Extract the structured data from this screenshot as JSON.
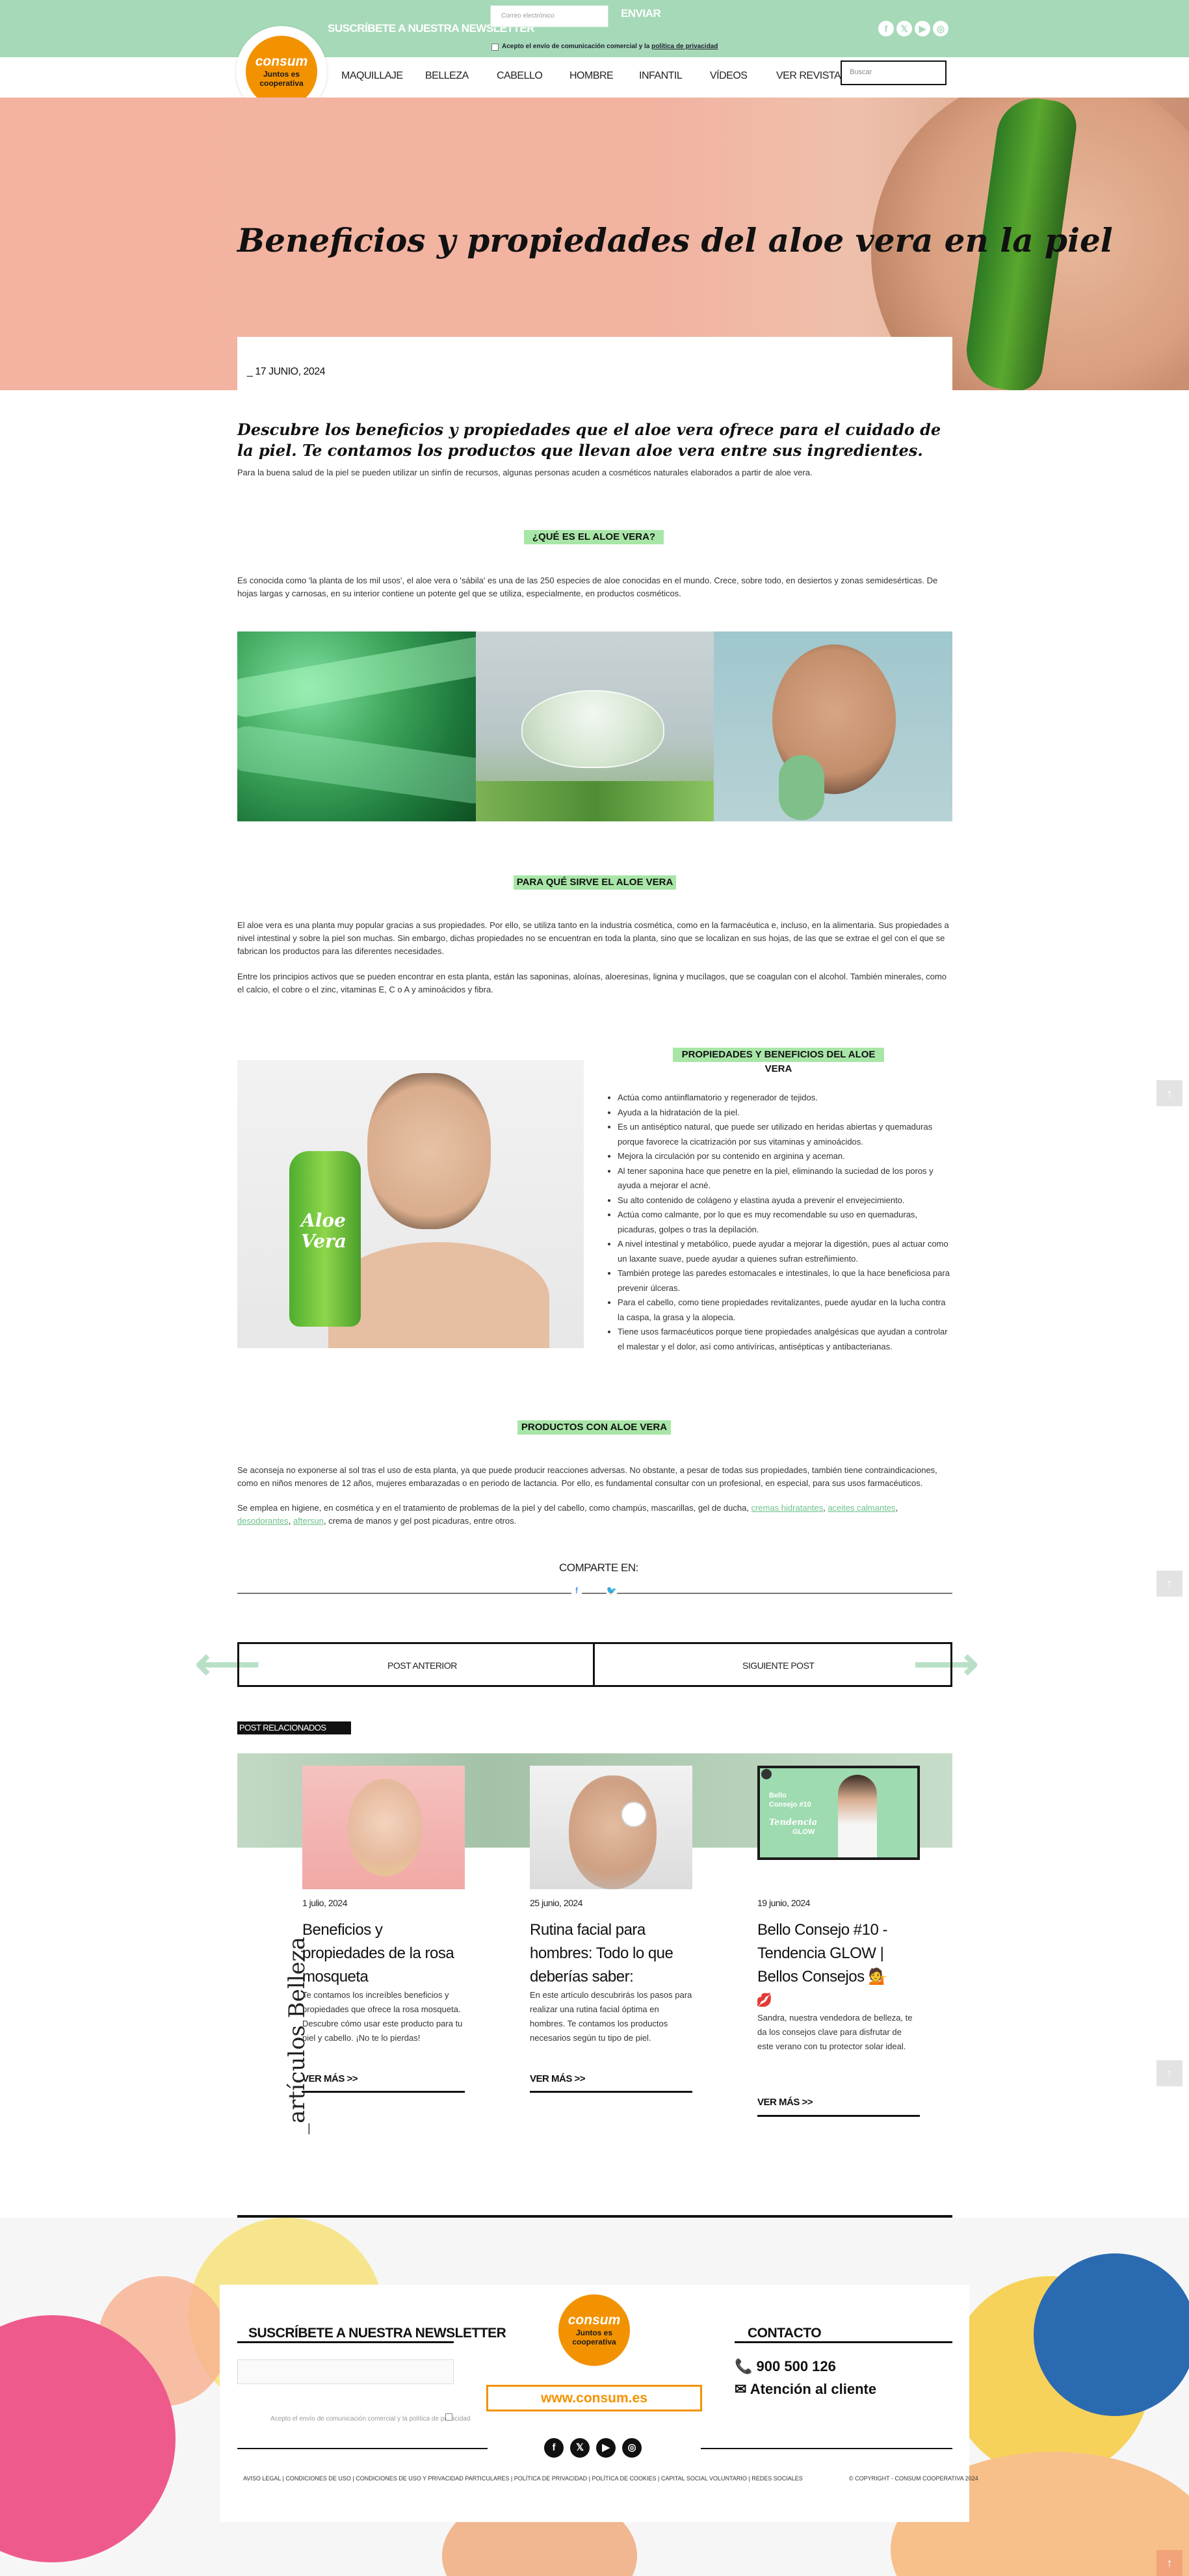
{
  "topbar": {
    "newsletter_title": "SUSCRÍBETE A NUESTRA NEWSLETTER",
    "email_placeholder": "Correo electrónico",
    "send_label": "ENVIAR",
    "accept_text": "Acepto el envío de comunicación comercial y la",
    "privacy_link": "política de privacidad",
    "social_icons": [
      "facebook-icon",
      "x-icon",
      "youtube-icon",
      "instagram-icon"
    ]
  },
  "brand": {
    "logo_word": "consum",
    "logo_sub_1": "Juntos es",
    "logo_sub_2": "cooperativa",
    "accent_color": "#f39200",
    "green_color": "#a6d9b8"
  },
  "nav": {
    "items": [
      "MAQUILLAJE",
      "BELLEZA",
      "CABELLO",
      "HOMBRE",
      "INFANTIL",
      "VÍDEOS",
      "VER REVISTA"
    ],
    "search_placeholder": "Buscar"
  },
  "hero": {
    "title": "Beneficios y propiedades del aloe vera en la piel",
    "date": "_ 17 JUNIO, 2024"
  },
  "article": {
    "intro_heading": "Descubre los beneficios y propiedades que el aloe vera ofrece para el cuidado de la piel. Te contamos los productos que llevan aloe vera entre sus ingredientes.",
    "intro_text": "Para la buena salud de la piel se pueden utilizar un sinfín de recursos, algunas personas acuden a cosméticos naturales elaborados a partir de aloe vera.",
    "section1_tag": "¿QUÉ ES EL ALOE VERA?",
    "section1_text": "Es conocida como 'la planta de los mil usos', el aloe vera o 'sábila' es una de las 250 especies de aloe conocidas en el mundo. Crece, sobre todo, en desiertos y zonas semidesérticas. De hojas largas y carnosas, en su interior contiene un potente gel que se utiliza, especialmente, en productos cosméticos.",
    "section2_tag": "PARA QUÉ SIRVE EL ALOE VERA",
    "section2_p1": "El aloe vera es una planta muy popular gracias a sus propiedades. Por ello, se utiliza tanto en la industria cosmética, como en la farmacéutica e, incluso, en la alimentaria. Sus propiedades a nivel intestinal y sobre la piel son muchas. Sin embargo, dichas propiedades no se encuentran en toda la planta, sino que se localizan en sus hojas, de las que se extrae el gel con el que se fabrican los productos para las diferentes necesidades.",
    "section2_p2": "Entre los principios activos que se pueden encontrar en esta planta, están las saponinas, aloínas, aloeresinas, lignina y mucílagos, que se coagulan con el alcohol. También minerales, como el calcio, el cobre o el zinc, vitaminas E, C o A y aminoácidos y fibra.",
    "section3_tag": "PROPIEDADES Y BENEFICIOS DEL ALOE VERA",
    "bottle_label_1": "Aloe",
    "bottle_label_2": "Vera",
    "benefits": [
      "Actúa como antiinflamatorio y regenerador de tejidos.",
      "Ayuda a la hidratación de la piel.",
      "Es un antiséptico natural, que puede ser utilizado en heridas abiertas y quemaduras porque favorece la cicatrización por sus vitaminas y aminoácidos.",
      "Mejora la circulación por su contenido en arginina y aceman.",
      "Al tener saponina hace que penetre en la piel, eliminando la suciedad de los poros y ayuda a mejorar el acné.",
      "Su alto contenido de colágeno y elastina ayuda a prevenir el envejecimiento.",
      "Actúa como calmante, por lo que es muy recomendable su uso en quemaduras, picaduras, golpes o tras la depilación.",
      "A nivel intestinal y metabólico, puede ayudar a mejorar la digestión, pues al actuar como un laxante suave, puede ayudar a quienes sufran estreñimiento.",
      "También protege las paredes estomacales e intestinales, lo que la hace beneficiosa para prevenir úlceras.",
      "Para el cabello, como tiene propiedades revitalizantes, puede ayudar en la lucha contra la caspa, la grasa y la alopecia.",
      "Tiene usos farmacéuticos porque tiene propiedades analgésicas que ayudan a controlar el malestar y el dolor, así como antivíricas, antisépticas y antibacterianas."
    ],
    "section4_tag": "PRODUCTOS CON ALOE VERA",
    "section4_p1": "Se aconseja no exponerse al sol tras el uso de esta planta, ya que puede producir reacciones adversas. No obstante, a pesar de todas sus propiedades, también tiene contraindicaciones, como en niños menores de 12 años, mujeres embarazadas o en periodo de lactancia. Por ello, es fundamental consultar con un profesional, en especial, para sus usos farmacéuticos.",
    "section4_p2_a": "Se emplea en higiene, en cosmética y en el tratamiento de problemas de la piel y del cabello, como champús, mascarillas, gel de ducha,",
    "link_1": "cremas hidratantes",
    "link_2": "aceites calmantes",
    "link_3": "desodorantes",
    "link_4": "aftersun",
    "section4_p2_b": ", crema de manos y gel post picaduras, entre otros."
  },
  "share": {
    "label": "COMPARTE EN:",
    "icons": [
      "facebook-icon",
      "twitter-icon"
    ]
  },
  "post_nav": {
    "prev": "POST ANTERIOR",
    "next": "SIGUIENTE POST"
  },
  "related": {
    "tag": "POST RELACIONADOS",
    "side_label": "_artículos Belleza",
    "video_title_1": "Bello",
    "video_title_2": "Consejo #10",
    "video_title_3": "Tendencia",
    "video_title_4": "GLOW",
    "cards": [
      {
        "date": "1 julio, 2024",
        "title": "Beneficios y propiedades de la rosa mosqueta",
        "text": "Te contamos los increíbles beneficios y propiedades que ofrece la rosa mosqueta. Descubre cómo usar este producto para tu piel y cabello. ¡No te lo pierdas!",
        "more": "VER MÁS >>"
      },
      {
        "date": "25 junio, 2024",
        "title": "Rutina facial para hombres: Todo lo que deberías saber:",
        "text": "En este artículo descubrirás los pasos para realizar una rutina facial óptima en hombres. Te contamos los productos necesarios según tu tipo de piel.",
        "more": "VER MÁS >>"
      },
      {
        "date": "19 junio, 2024",
        "title": "Bello Consejo #10 - Tendencia GLOW | Bellos Consejos 💁",
        "title_extra": "💋",
        "text": "Sandra, nuestra vendedora de belleza, te da los consejos clave para disfrutar de este verano con tu protector solar ideal.",
        "more": "VER MÁS >>"
      }
    ]
  },
  "footer": {
    "newsletter_title": "SUSCRÍBETE A NUESTRA NEWSLETTER",
    "accept_text": "Acepto el envío de comunicación comercial y la política de privacidad",
    "url": "www.consum.es",
    "contact_title": "CONTACTO",
    "phone": "900 500 126",
    "attention": "Atención al cliente",
    "social_icons": [
      "facebook-icon",
      "x-icon",
      "youtube-icon",
      "instagram-icon"
    ],
    "legal_links": "AVISO LEGAL  |  CONDICIONES DE USO  |  CONDICIONES DE USO Y PRIVACIDAD PARTICULARES  |  POLÍTICA DE PRIVACIDAD  |  POLÍTICA DE COOKIES  |  CAPITAL SOCIAL VOLUNTARIO  |  REDES SOCIALES",
    "copyright": "© COPYRIGHT - CONSUM COOPERATIVA 2024"
  }
}
